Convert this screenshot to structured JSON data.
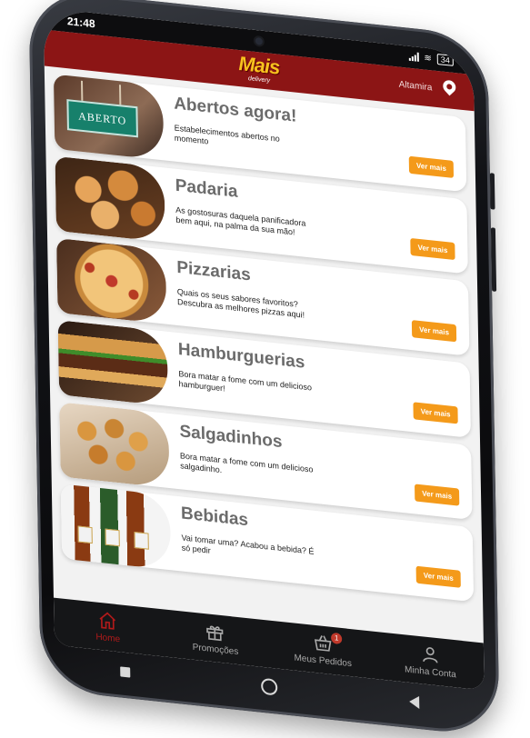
{
  "status": {
    "time": "21:48",
    "battery": "34"
  },
  "header": {
    "logo": "Mais",
    "logo_sub": "delivery",
    "city": "Altamira"
  },
  "categories": [
    {
      "title": "Abertos agora!",
      "description": "Estabelecimentos abertos no momento",
      "button": "Ver mais",
      "image_text": "ABERTO"
    },
    {
      "title": "Padaria",
      "description": "As gostosuras daquela panificadora bem aqui, na palma da sua mão!",
      "button": "Ver mais"
    },
    {
      "title": "Pizzarias",
      "description": "Quais os seus sabores favoritos? Descubra as melhores pizzas aqui!",
      "button": "Ver mais"
    },
    {
      "title": "Hamburguerias",
      "description": "Bora matar a fome com um delicioso hamburguer!",
      "button": "Ver mais"
    },
    {
      "title": "Salgadinhos",
      "description": "Bora matar a fome com um delicioso salgadinho.",
      "button": "Ver mais"
    },
    {
      "title": "Bebidas",
      "description": "Vai tomar uma? Acabou a bebida? É só pedir",
      "button": "Ver mais"
    }
  ],
  "tabs": [
    {
      "label": "Home",
      "icon": "home-icon",
      "active": true
    },
    {
      "label": "Promoções",
      "icon": "gift-icon",
      "active": false
    },
    {
      "label": "Meus Pedidos",
      "icon": "basket-icon",
      "active": false,
      "badge": "1"
    },
    {
      "label": "Minha Conta",
      "icon": "user-icon",
      "active": false
    }
  ],
  "colors": {
    "header": "#8c1515",
    "accent": "#f49a1a",
    "active_tab": "#b11a1a",
    "logo": "#f7c21e"
  }
}
